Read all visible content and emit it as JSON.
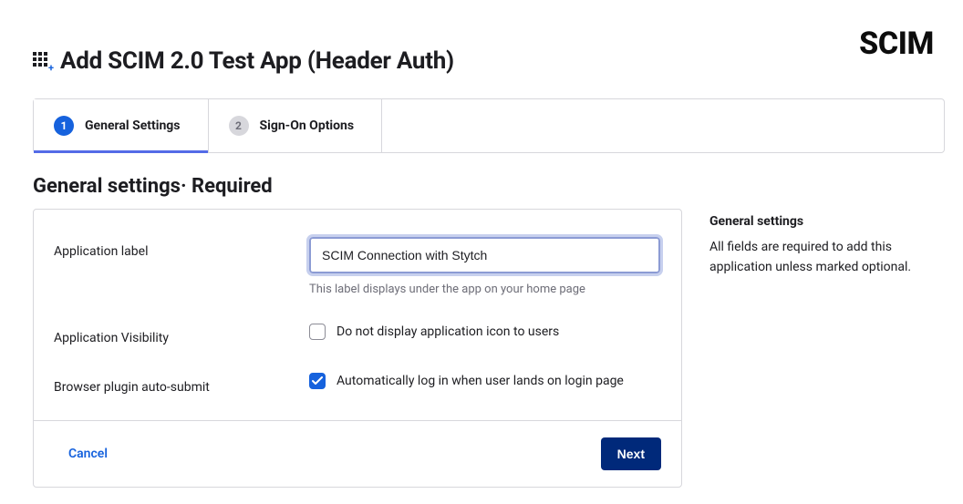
{
  "header": {
    "title": "Add SCIM 2.0 Test App (Header Auth)",
    "logo": "SCIM"
  },
  "tabs": [
    {
      "num": "1",
      "label": "General Settings",
      "active": true
    },
    {
      "num": "2",
      "label": "Sign-On Options",
      "active": false
    }
  ],
  "section_heading": "General settings· Required",
  "form": {
    "application_label": {
      "label": "Application label",
      "value": "SCIM Connection with Stytch",
      "helper": "This label displays under the app on your home page"
    },
    "visibility": {
      "label": "Application Visibility",
      "checkbox_label": "Do not display application icon to users",
      "checked": false
    },
    "auto_submit": {
      "label": "Browser plugin auto-submit",
      "checkbox_label": "Automatically log in when user lands on login page",
      "checked": true
    }
  },
  "actions": {
    "cancel": "Cancel",
    "next": "Next"
  },
  "sidebar": {
    "title": "General settings",
    "text": "All fields are required to add this application unless marked optional."
  }
}
